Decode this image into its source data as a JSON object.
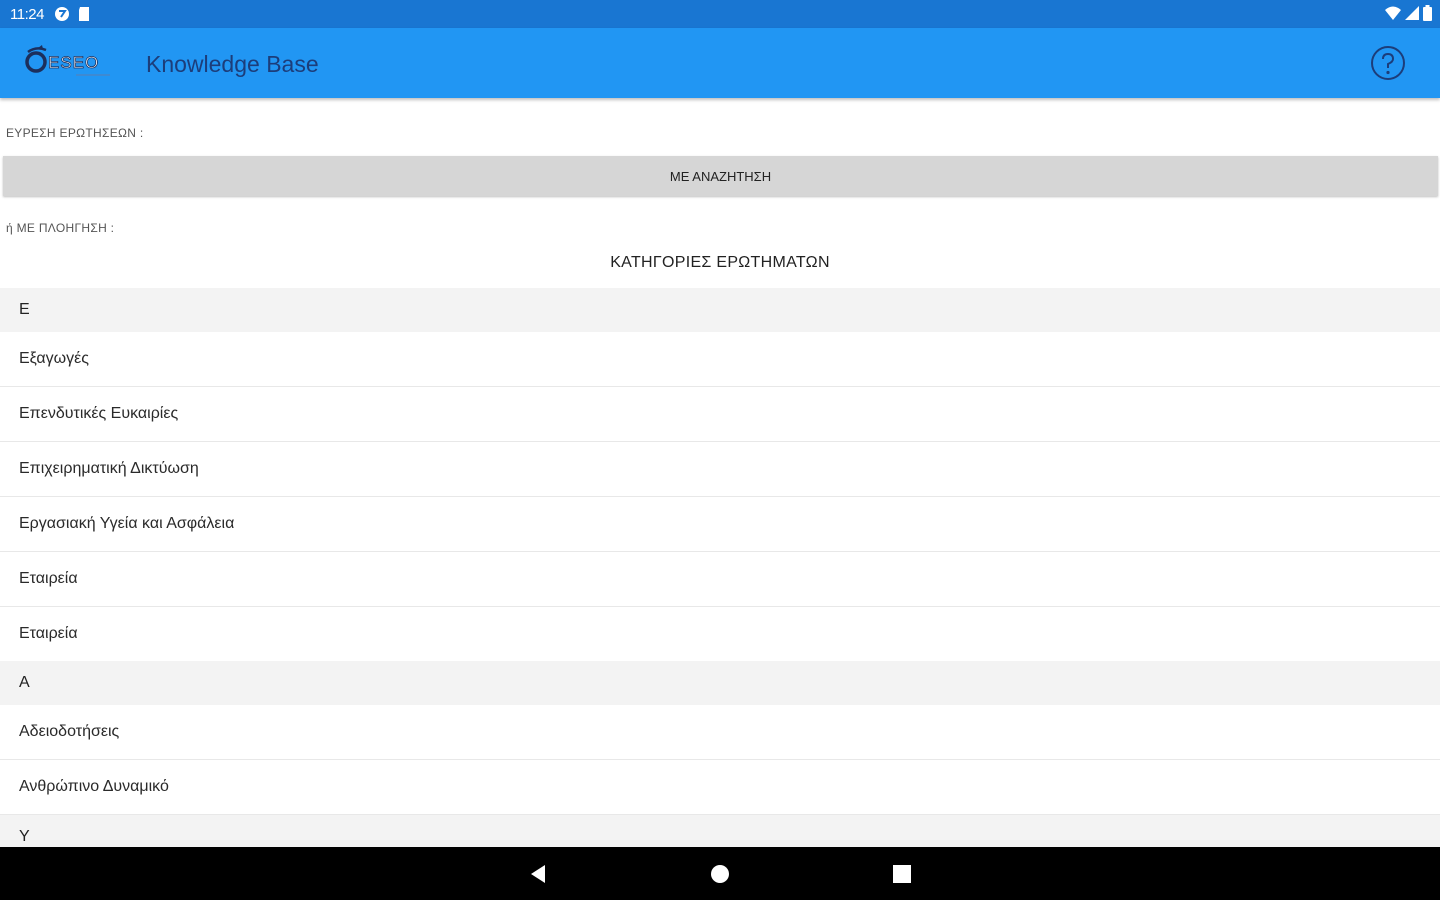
{
  "status_bar": {
    "time": "11:24",
    "icons": [
      "app-notification-icon",
      "sd-card-icon",
      "wifi-icon",
      "signal-icon",
      "battery-icon"
    ]
  },
  "app_bar": {
    "logo_text": "ESEO",
    "title": "Knowledge Base",
    "help_icon": "help-circle-icon",
    "background": "#2196f3"
  },
  "main": {
    "find_label": "ΕΥΡΕΣΗ ΕΡΩΤΗΣΕΩΝ :",
    "search_button": "ΜΕ ΑΝΑΖΗΤΗΣΗ",
    "browse_label": "ή ΜΕ ΠΛΟΗΓΗΣΗ :",
    "categories_title": "ΚΑΤΗΓΟΡΙΕΣ ΕΡΩΤΗΜΑΤΩΝ",
    "groups": [
      {
        "header": "Ε",
        "items": [
          "Εξαγωγές",
          "Επενδυτικές Ευκαιρίες",
          "Επιχειρηματική Δικτύωση",
          "Εργασιακή Υγεία και Ασφάλεια",
          "Εταιρεία",
          "Εταιρεία"
        ]
      },
      {
        "header": "Α",
        "items": [
          "Αδειοδοτήσεις",
          "Ανθρώπινο Δυναμικό"
        ]
      },
      {
        "header": "Υ",
        "items": []
      }
    ]
  },
  "nav_bar": {
    "buttons": [
      "back-icon",
      "home-icon",
      "recents-icon"
    ]
  }
}
